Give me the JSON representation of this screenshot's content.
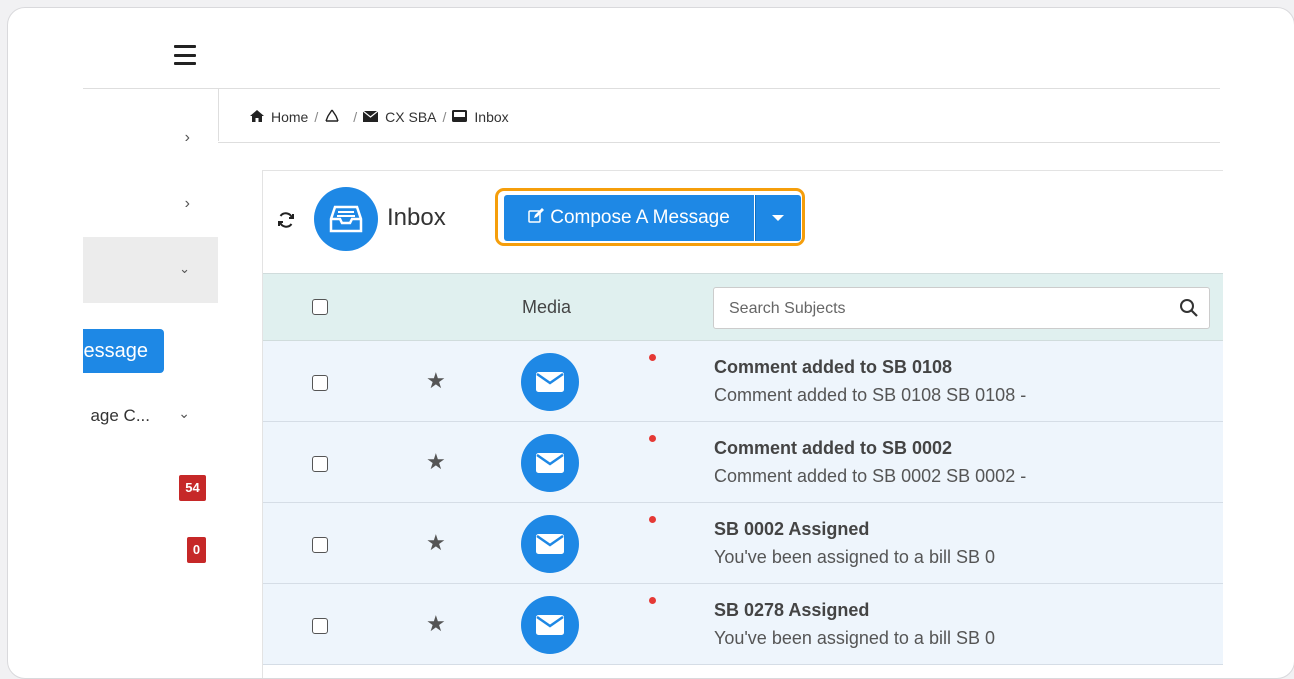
{
  "sidebar": {
    "partial_button_label": "essage",
    "manage_label": "age C...",
    "badges": [
      "54",
      "0"
    ]
  },
  "breadcrumb": {
    "home": "Home",
    "separator": "/",
    "cx_sba": "CX SBA",
    "inbox": "Inbox"
  },
  "toolbar": {
    "title": "Inbox",
    "compose_label": "Compose A Message"
  },
  "table": {
    "media_header": "Media",
    "search_placeholder": "Search Subjects",
    "rows": [
      {
        "subject": "Comment added to SB 0108",
        "preview": "Comment added to SB 0108 SB 0108 -",
        "unread": true
      },
      {
        "subject": "Comment added to SB 0002",
        "preview": "Comment added to SB 0002 SB 0002 -",
        "unread": true
      },
      {
        "subject": "SB 0002 Assigned",
        "preview": "You've been assigned to a bill SB 0",
        "unread": true
      },
      {
        "subject": "SB 0278 Assigned",
        "preview": "You've been assigned to a bill SB 0",
        "unread": true
      }
    ]
  },
  "colors": {
    "primary": "#1e88e5",
    "highlight_outline": "#f59e0b",
    "badge": "#c62828",
    "header_bg": "#e0f0ef",
    "row_bg": "#eef5fc"
  },
  "icons": [
    "hamburger-icon",
    "chevron-right-icon",
    "chevron-down-icon",
    "home-icon",
    "recycle-icon",
    "envelope-icon",
    "inbox-tray-icon",
    "refresh-icon",
    "edit-icon",
    "caret-down-icon",
    "search-icon",
    "star-icon"
  ]
}
